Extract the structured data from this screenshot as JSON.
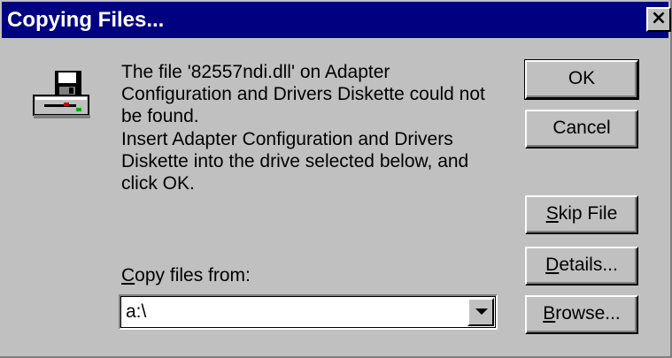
{
  "dialog": {
    "title": "Copying Files...",
    "close_label": "×",
    "message_line1": "The file '82557ndi.dll' on Adapter Configuration and Drivers Diskette could not be found.",
    "message_line2": "Insert Adapter Configuration and Drivers Diskette into the drive selected below, and click OK.",
    "copy_from_label_accel": "C",
    "copy_from_label_rest": "opy files from:",
    "copy_from_value": "a:\\"
  },
  "buttons": {
    "ok": "OK",
    "cancel": "Cancel",
    "skip_accel": "S",
    "skip_rest": "kip File",
    "details_accel": "D",
    "details_rest": "etails...",
    "browse_accel": "B",
    "browse_rest": "rowse..."
  },
  "icons": {
    "dialog_icon": "floppy-drive-icon",
    "dropdown": "chevron-down-icon"
  },
  "colors": {
    "titlebar": "#000080",
    "face": "#c0c0c0"
  }
}
